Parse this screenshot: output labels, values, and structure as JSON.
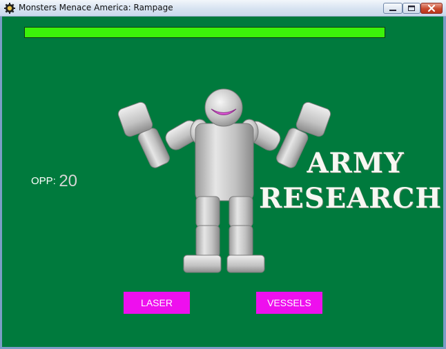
{
  "window": {
    "title": "Monsters Menace America: Rampage"
  },
  "hud": {
    "health_fraction": 1.0,
    "opp_label": "OPP:",
    "opp_value": "20"
  },
  "screen": {
    "title_line1": "ARMY",
    "title_line2": "RESEARCH"
  },
  "buttons": {
    "laser": "LASER",
    "vessels": "VESSELS"
  },
  "colors": {
    "background": "#007a3d",
    "health": "#3cf20a",
    "button": "#ee0fee",
    "robot": "#c4c4c4",
    "mouth": "#e05ad8"
  },
  "icons": {
    "app": "gear-icon",
    "minimize": "minimize-icon",
    "maximize": "maximize-icon",
    "close": "close-icon"
  }
}
